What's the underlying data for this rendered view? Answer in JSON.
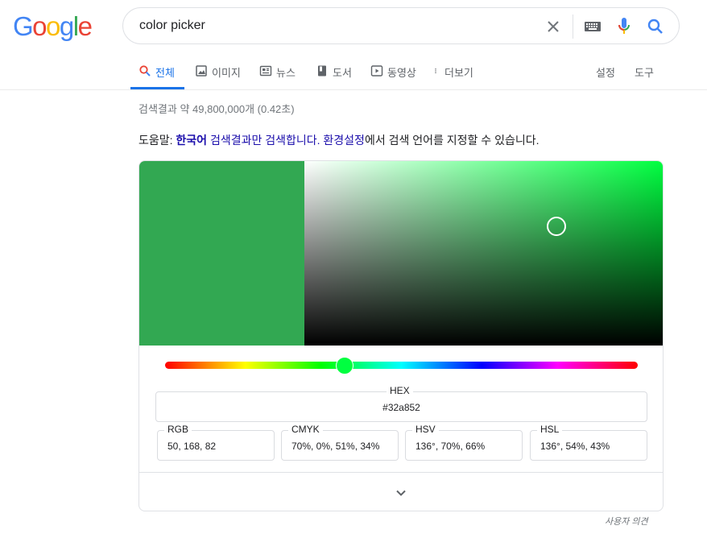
{
  "logo": {
    "letters": [
      "G",
      "o",
      "o",
      "g",
      "l",
      "e"
    ],
    "colors": [
      "#4285f4",
      "#ea4335",
      "#fbbc05",
      "#4285f4",
      "#34a853",
      "#ea4335"
    ]
  },
  "search": {
    "query": "color picker"
  },
  "tabs": [
    {
      "label": "전체",
      "icon": "search-icon",
      "active": true
    },
    {
      "label": "이미지",
      "icon": "image-icon"
    },
    {
      "label": "뉴스",
      "icon": "news-icon"
    },
    {
      "label": "도서",
      "icon": "book-icon"
    },
    {
      "label": "동영상",
      "icon": "play-icon"
    },
    {
      "label": "더보기",
      "icon": "more-vert-icon"
    }
  ],
  "tools": {
    "settings": "설정",
    "tools": "도구"
  },
  "result_stats": "검색결과 약 49,800,000개 (0.42초)",
  "tip": {
    "prefix": "도움말: ",
    "lang": "한국어",
    "link1": " 검색결과만 검색합니다.",
    "link2": "환경설정",
    "suffix": "에서 검색 언어를 지정할 수 있습니다."
  },
  "picker": {
    "current_color": "#32a852",
    "hue_color": "#00ff40",
    "hex_label": "HEX",
    "hex_value": "#32a852",
    "fields": [
      {
        "label": "RGB",
        "value": "50, 168, 82"
      },
      {
        "label": "CMYK",
        "value": "70%, 0%, 51%, 34%"
      },
      {
        "label": "HSV",
        "value": "136°, 70%, 66%"
      },
      {
        "label": "HSL",
        "value": "136°, 54%, 43%"
      }
    ],
    "hue_degrees": 136,
    "saturation_pct": 70,
    "value_pct": 66
  },
  "feedback": "사용자 의견"
}
